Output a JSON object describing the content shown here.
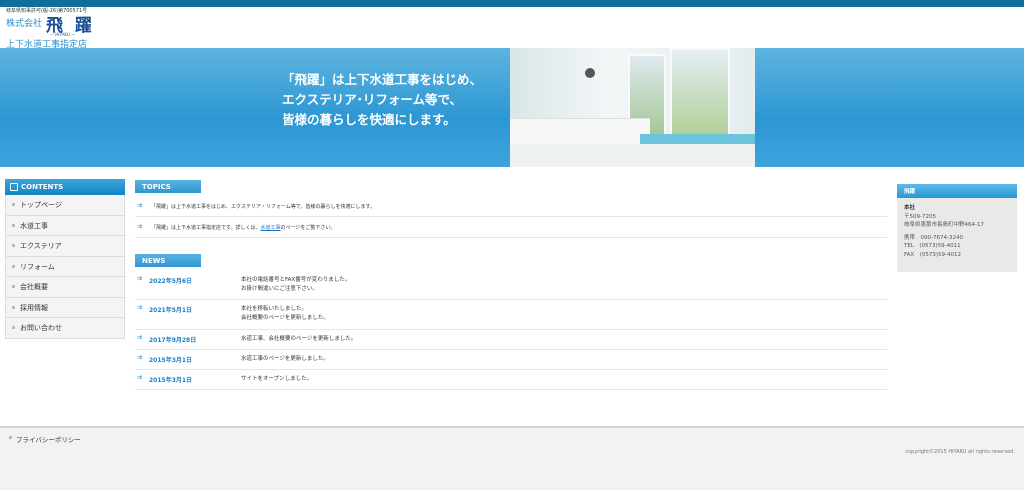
{
  "header": {
    "license": "岐阜県知事許可(般-26)第700571号",
    "company_prefix": "株式会社",
    "logo": "飛 躍",
    "logo_sub": "— HIYAKU —",
    "shop": "上下水道工事指定店"
  },
  "banner": {
    "line1": "「飛躍」は上下水道工事をはじめ、",
    "line2": "エクステリア･リフォーム等で、",
    "line3": "皆様の暮らしを快適にします。"
  },
  "sidebar": {
    "heading": "CONTENTS",
    "items": [
      {
        "label": "トップページ"
      },
      {
        "label": "水道工事"
      },
      {
        "label": "エクステリア"
      },
      {
        "label": "リフォーム"
      },
      {
        "label": "会社概要"
      },
      {
        "label": "採用情報"
      },
      {
        "label": "お問い合わせ"
      }
    ]
  },
  "topics": {
    "heading": "TOPICS",
    "item1": "「飛躍」は上下水道工事をはじめ、エクステリア・リフォーム等で、皆様の暮らしを快適にします。",
    "item2_pre": "「飛躍」は上下水道工事指定店です。詳しくは、",
    "item2_link": "水道工事",
    "item2_post": "のページをご覧下さい。"
  },
  "news": {
    "heading": "NEWS",
    "items": [
      {
        "date": "2022年5月6日",
        "line1": "本社の電話番号とFAX番号が変わりました。",
        "line2": "お掛け間違いにご注意下さい。"
      },
      {
        "date": "2021年5月1日",
        "line1": "本社を移転いたしました。",
        "line2": "会社概要のページを更新しました。"
      },
      {
        "date": "2017年9月28日",
        "line1": "水道工事、会社概要のページを更新しました。",
        "line2": ""
      },
      {
        "date": "2015年3月1日",
        "line1": "水道工事のページを更新しました。",
        "line2": ""
      },
      {
        "date": "2015年3月1日",
        "line1": "サイトをオープンしました。",
        "line2": ""
      }
    ]
  },
  "info": {
    "heading": "飛躍",
    "office": "本社",
    "zip": "〒509-7205",
    "address": "岐阜県恵那市長島町中野464-17",
    "mobile": "携帯　090-7674-3240",
    "tel": "TEL　(0573)59-4011",
    "fax": "FAX　(0573)59-4012"
  },
  "footer": {
    "privacy": "プライバシーポリシー",
    "copyright": "copyright©2015 HIYAKU all rights reserved."
  }
}
